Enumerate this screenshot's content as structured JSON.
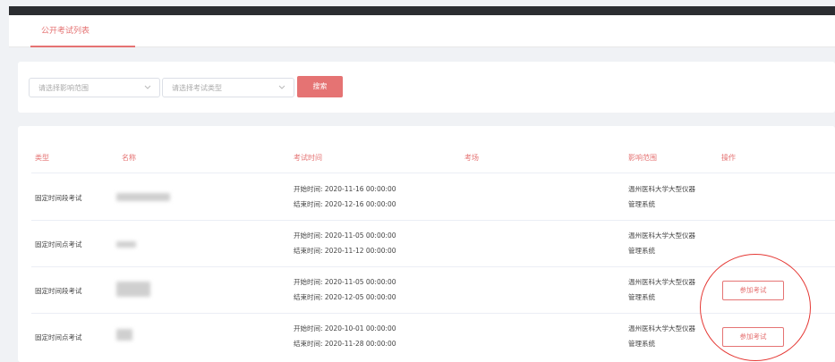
{
  "tabs": {
    "active_label": "公开考试列表"
  },
  "filters": {
    "scope_placeholder": "请选择影响范围",
    "type_placeholder": "请选择考试类型",
    "search_label": "搜索"
  },
  "table": {
    "headers": {
      "type": "类型",
      "name": "名称",
      "time": "考试时间",
      "venue": "考场",
      "scope": "影响范围",
      "action": "操作"
    },
    "rows": [
      {
        "type": "固定时间段考试",
        "start": "开始时间: 2020-11-16 00:00:00",
        "end": "结束时间: 2020-12-16 00:00:00",
        "scope_line1": "温州医科大学大型仪器",
        "scope_line2": "管理系统",
        "action": ""
      },
      {
        "type": "固定时间点考试",
        "start": "开始时间: 2020-11-05 00:00:00",
        "end": "结束时间: 2020-11-12 00:00:00",
        "scope_line1": "温州医科大学大型仪器",
        "scope_line2": "管理系统",
        "action": ""
      },
      {
        "type": "固定时间段考试",
        "start": "开始时间: 2020-11-05 00:00:00",
        "end": "结束时间: 2020-12-05 00:00:00",
        "scope_line1": "温州医科大学大型仪器",
        "scope_line2": "管理系统",
        "action": "参加考试"
      },
      {
        "type": "固定时间点考试",
        "start": "开始时间: 2020-10-01 00:00:00",
        "end": "结束时间: 2020-11-28 00:00:00",
        "scope_line1": "温州医科大学大型仪器",
        "scope_line2": "管理系统",
        "action": "参加考试"
      }
    ]
  },
  "colors": {
    "accent": "#e57373",
    "annotation": "#e53935",
    "topbar": "#2b2d31"
  }
}
